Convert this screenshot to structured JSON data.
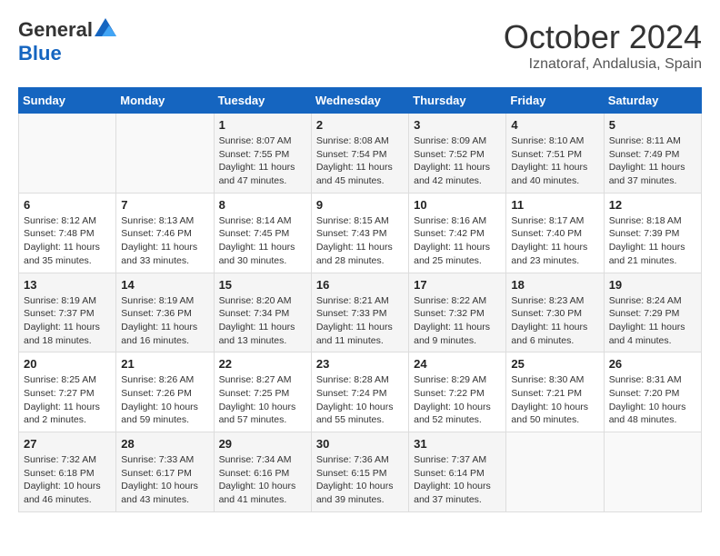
{
  "header": {
    "logo_general": "General",
    "logo_blue": "Blue",
    "title": "October 2024",
    "subtitle": "Iznatoraf, Andalusia, Spain"
  },
  "columns": [
    "Sunday",
    "Monday",
    "Tuesday",
    "Wednesday",
    "Thursday",
    "Friday",
    "Saturday"
  ],
  "weeks": [
    [
      {
        "day": "",
        "sunrise": "",
        "sunset": "",
        "daylight": ""
      },
      {
        "day": "",
        "sunrise": "",
        "sunset": "",
        "daylight": ""
      },
      {
        "day": "1",
        "sunrise": "Sunrise: 8:07 AM",
        "sunset": "Sunset: 7:55 PM",
        "daylight": "Daylight: 11 hours and 47 minutes."
      },
      {
        "day": "2",
        "sunrise": "Sunrise: 8:08 AM",
        "sunset": "Sunset: 7:54 PM",
        "daylight": "Daylight: 11 hours and 45 minutes."
      },
      {
        "day": "3",
        "sunrise": "Sunrise: 8:09 AM",
        "sunset": "Sunset: 7:52 PM",
        "daylight": "Daylight: 11 hours and 42 minutes."
      },
      {
        "day": "4",
        "sunrise": "Sunrise: 8:10 AM",
        "sunset": "Sunset: 7:51 PM",
        "daylight": "Daylight: 11 hours and 40 minutes."
      },
      {
        "day": "5",
        "sunrise": "Sunrise: 8:11 AM",
        "sunset": "Sunset: 7:49 PM",
        "daylight": "Daylight: 11 hours and 37 minutes."
      }
    ],
    [
      {
        "day": "6",
        "sunrise": "Sunrise: 8:12 AM",
        "sunset": "Sunset: 7:48 PM",
        "daylight": "Daylight: 11 hours and 35 minutes."
      },
      {
        "day": "7",
        "sunrise": "Sunrise: 8:13 AM",
        "sunset": "Sunset: 7:46 PM",
        "daylight": "Daylight: 11 hours and 33 minutes."
      },
      {
        "day": "8",
        "sunrise": "Sunrise: 8:14 AM",
        "sunset": "Sunset: 7:45 PM",
        "daylight": "Daylight: 11 hours and 30 minutes."
      },
      {
        "day": "9",
        "sunrise": "Sunrise: 8:15 AM",
        "sunset": "Sunset: 7:43 PM",
        "daylight": "Daylight: 11 hours and 28 minutes."
      },
      {
        "day": "10",
        "sunrise": "Sunrise: 8:16 AM",
        "sunset": "Sunset: 7:42 PM",
        "daylight": "Daylight: 11 hours and 25 minutes."
      },
      {
        "day": "11",
        "sunrise": "Sunrise: 8:17 AM",
        "sunset": "Sunset: 7:40 PM",
        "daylight": "Daylight: 11 hours and 23 minutes."
      },
      {
        "day": "12",
        "sunrise": "Sunrise: 8:18 AM",
        "sunset": "Sunset: 7:39 PM",
        "daylight": "Daylight: 11 hours and 21 minutes."
      }
    ],
    [
      {
        "day": "13",
        "sunrise": "Sunrise: 8:19 AM",
        "sunset": "Sunset: 7:37 PM",
        "daylight": "Daylight: 11 hours and 18 minutes."
      },
      {
        "day": "14",
        "sunrise": "Sunrise: 8:19 AM",
        "sunset": "Sunset: 7:36 PM",
        "daylight": "Daylight: 11 hours and 16 minutes."
      },
      {
        "day": "15",
        "sunrise": "Sunrise: 8:20 AM",
        "sunset": "Sunset: 7:34 PM",
        "daylight": "Daylight: 11 hours and 13 minutes."
      },
      {
        "day": "16",
        "sunrise": "Sunrise: 8:21 AM",
        "sunset": "Sunset: 7:33 PM",
        "daylight": "Daylight: 11 hours and 11 minutes."
      },
      {
        "day": "17",
        "sunrise": "Sunrise: 8:22 AM",
        "sunset": "Sunset: 7:32 PM",
        "daylight": "Daylight: 11 hours and 9 minutes."
      },
      {
        "day": "18",
        "sunrise": "Sunrise: 8:23 AM",
        "sunset": "Sunset: 7:30 PM",
        "daylight": "Daylight: 11 hours and 6 minutes."
      },
      {
        "day": "19",
        "sunrise": "Sunrise: 8:24 AM",
        "sunset": "Sunset: 7:29 PM",
        "daylight": "Daylight: 11 hours and 4 minutes."
      }
    ],
    [
      {
        "day": "20",
        "sunrise": "Sunrise: 8:25 AM",
        "sunset": "Sunset: 7:27 PM",
        "daylight": "Daylight: 11 hours and 2 minutes."
      },
      {
        "day": "21",
        "sunrise": "Sunrise: 8:26 AM",
        "sunset": "Sunset: 7:26 PM",
        "daylight": "Daylight: 10 hours and 59 minutes."
      },
      {
        "day": "22",
        "sunrise": "Sunrise: 8:27 AM",
        "sunset": "Sunset: 7:25 PM",
        "daylight": "Daylight: 10 hours and 57 minutes."
      },
      {
        "day": "23",
        "sunrise": "Sunrise: 8:28 AM",
        "sunset": "Sunset: 7:24 PM",
        "daylight": "Daylight: 10 hours and 55 minutes."
      },
      {
        "day": "24",
        "sunrise": "Sunrise: 8:29 AM",
        "sunset": "Sunset: 7:22 PM",
        "daylight": "Daylight: 10 hours and 52 minutes."
      },
      {
        "day": "25",
        "sunrise": "Sunrise: 8:30 AM",
        "sunset": "Sunset: 7:21 PM",
        "daylight": "Daylight: 10 hours and 50 minutes."
      },
      {
        "day": "26",
        "sunrise": "Sunrise: 8:31 AM",
        "sunset": "Sunset: 7:20 PM",
        "daylight": "Daylight: 10 hours and 48 minutes."
      }
    ],
    [
      {
        "day": "27",
        "sunrise": "Sunrise: 7:32 AM",
        "sunset": "Sunset: 6:18 PM",
        "daylight": "Daylight: 10 hours and 46 minutes."
      },
      {
        "day": "28",
        "sunrise": "Sunrise: 7:33 AM",
        "sunset": "Sunset: 6:17 PM",
        "daylight": "Daylight: 10 hours and 43 minutes."
      },
      {
        "day": "29",
        "sunrise": "Sunrise: 7:34 AM",
        "sunset": "Sunset: 6:16 PM",
        "daylight": "Daylight: 10 hours and 41 minutes."
      },
      {
        "day": "30",
        "sunrise": "Sunrise: 7:36 AM",
        "sunset": "Sunset: 6:15 PM",
        "daylight": "Daylight: 10 hours and 39 minutes."
      },
      {
        "day": "31",
        "sunrise": "Sunrise: 7:37 AM",
        "sunset": "Sunset: 6:14 PM",
        "daylight": "Daylight: 10 hours and 37 minutes."
      },
      {
        "day": "",
        "sunrise": "",
        "sunset": "",
        "daylight": ""
      },
      {
        "day": "",
        "sunrise": "",
        "sunset": "",
        "daylight": ""
      }
    ]
  ]
}
